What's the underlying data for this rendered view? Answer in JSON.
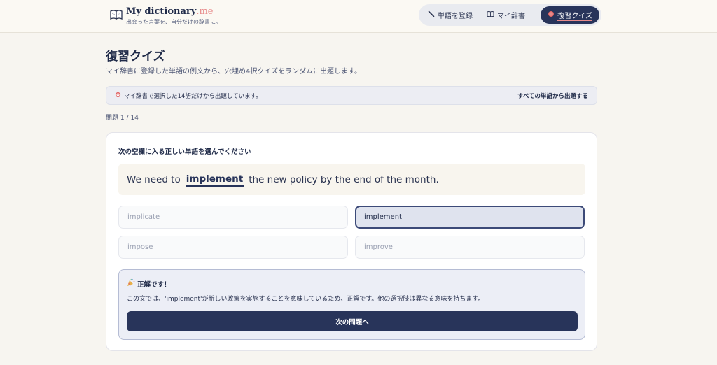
{
  "header": {
    "brand_title": "My dictionary",
    "brand_suffix": ".me",
    "brand_subtitle": "出会った言葉を、自分だけの辞書に。",
    "nav": [
      {
        "label": "単語を登録",
        "icon": "pen-icon"
      },
      {
        "label": "マイ辞書",
        "icon": "book-icon"
      },
      {
        "label": "復習クイズ",
        "icon": "target-icon",
        "active": true
      }
    ]
  },
  "page": {
    "title": "復習クイズ",
    "description": "マイ辞書に登録した単語の例文から、穴埋め4択クイズをランダムに出題します。"
  },
  "notice": {
    "text": "マイ辞書で選択した14語だけから出題しています。",
    "link": "すべての単語から出題する"
  },
  "counter": "問題 1 / 14",
  "quiz": {
    "instruction": "次の空欄に入る正しい単語を選んでください",
    "sentence_before": "We need to",
    "sentence_blank": "implement",
    "sentence_after": "the new policy by the end of the month.",
    "options": [
      "implicate",
      "implement",
      "impose",
      "improve"
    ],
    "selected_index": 1
  },
  "feedback": {
    "title": "正解です！",
    "text": "この文では、'implement'が新しい政策を実施することを意味しているため、正解です。他の選択肢は異なる意味を持ちます。",
    "next_button": "次の問題へ"
  },
  "colors": {
    "primary": "#28345a",
    "accent": "#e78a8a",
    "background": "#f7f5f0"
  }
}
